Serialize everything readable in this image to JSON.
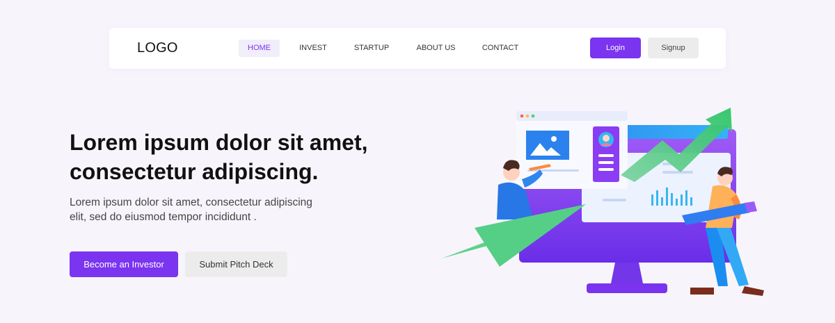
{
  "nav": {
    "logo": "LOGO",
    "items": [
      {
        "label": "HOME",
        "active": true
      },
      {
        "label": "INVEST",
        "active": false
      },
      {
        "label": "STARTUP",
        "active": false
      },
      {
        "label": "ABOUT US",
        "active": false
      },
      {
        "label": "CONTACT",
        "active": false
      }
    ],
    "login_label": "Login",
    "signup_label": "Signup"
  },
  "hero": {
    "title_line1": "Lorem ipsum dolor sit amet,",
    "title_line2": "consectetur adipiscing.",
    "subtitle_line1": "Lorem ipsum dolor sit amet, consectetur adipiscing",
    "subtitle_line2": "elit, sed do eiusmod tempor incididunt .",
    "primary_cta": "Become an Investor",
    "secondary_cta": "Submit Pitch Deck"
  },
  "colors": {
    "accent": "#7b34ef",
    "background": "#f7f5fb",
    "active_nav_bg": "#f1eefb"
  }
}
